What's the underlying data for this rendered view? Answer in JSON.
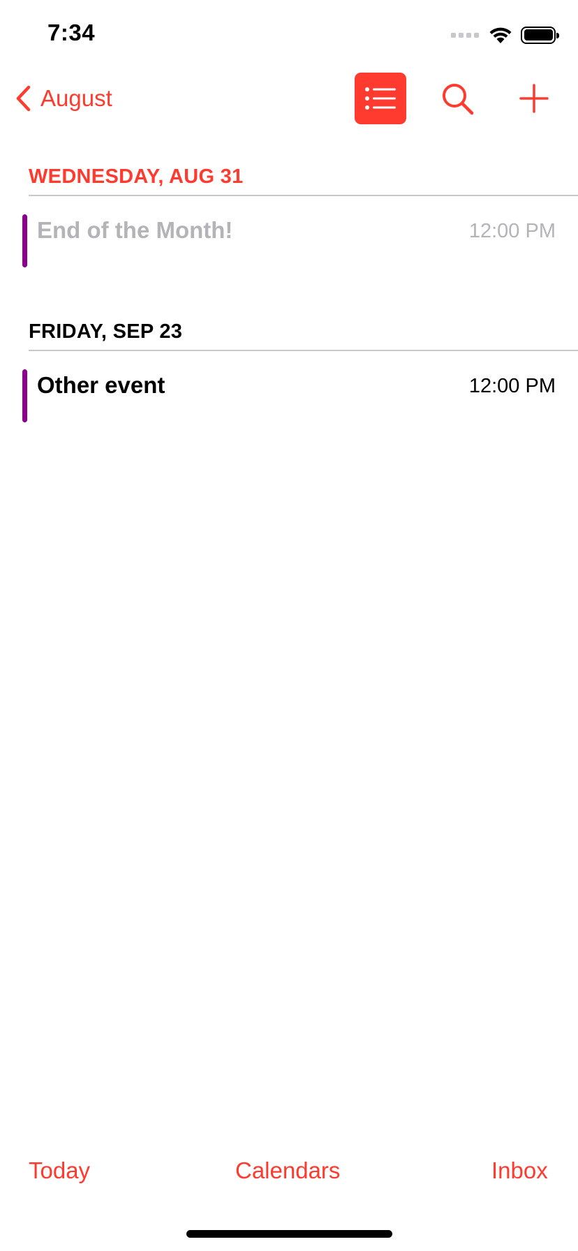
{
  "status_bar": {
    "time": "7:34"
  },
  "nav": {
    "back_label": "August",
    "back_icon": "chevron-left-icon",
    "list_icon": "list-icon",
    "search_icon": "search-icon",
    "add_icon": "plus-icon"
  },
  "days": [
    {
      "header": "WEDNESDAY, AUG 31",
      "events": [
        {
          "title": "End of the Month!",
          "time": "12:00 PM"
        }
      ]
    },
    {
      "header": "FRIDAY, SEP 23",
      "events": [
        {
          "title": "Other event",
          "time": "12:00 PM"
        }
      ]
    }
  ],
  "tab_bar": {
    "today": "Today",
    "calendars": "Calendars",
    "inbox": "Inbox"
  },
  "colors": {
    "accent": "#ff3b30",
    "event_calendar": "#8b008b",
    "past_text": "#b4b4b8"
  }
}
